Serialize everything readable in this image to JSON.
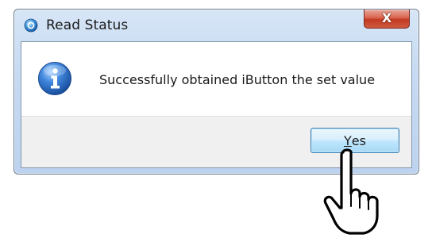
{
  "dialog": {
    "title": "Read Status",
    "message": "Successfully obtained iButton the set value",
    "close_glyph": "X",
    "buttons": {
      "yes": {
        "mnemonic": "Y",
        "rest": "es"
      }
    }
  },
  "icons": {
    "app": "app-icon",
    "message": "info-icon",
    "pointer": "pointing-hand-icon"
  },
  "colors": {
    "frame": "#c7dbf2",
    "close_button": "#c23b22",
    "info_icon": "#1e5fb4",
    "button_area": "#f0f0f0"
  }
}
